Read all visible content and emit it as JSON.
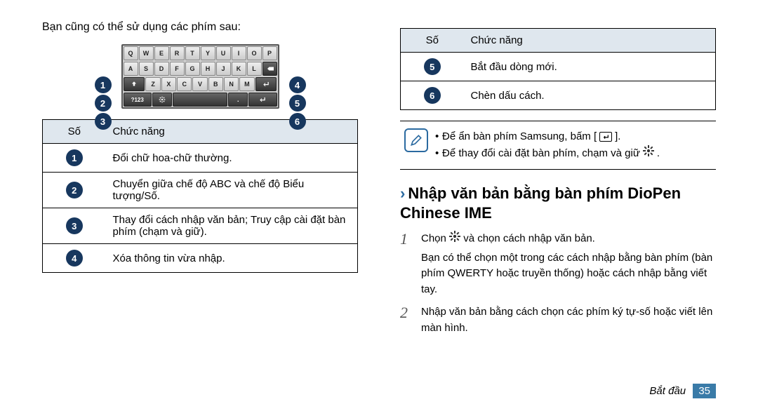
{
  "left": {
    "intro": "Bạn cũng có thể sử dụng các phím sau:",
    "keyboard_numbers": [
      "1",
      "2",
      "3",
      "4",
      "5",
      "6"
    ],
    "table": {
      "head": {
        "num": "Số",
        "func": "Chức năng"
      },
      "rows": [
        {
          "num": "1",
          "func": "Đổi chữ hoa-chữ thường."
        },
        {
          "num": "2",
          "func": "Chuyển giữa chế độ ABC và chế độ Biểu tượng/Số."
        },
        {
          "num": "3",
          "func": "Thay đổi cách nhập văn bản; Truy cập cài đặt bàn phím (chạm và giữ)."
        },
        {
          "num": "4",
          "func": "Xóa thông tin vừa nhập."
        }
      ]
    }
  },
  "right": {
    "table": {
      "head": {
        "num": "Số",
        "func": "Chức năng"
      },
      "rows": [
        {
          "num": "5",
          "func": "Bắt đầu dòng mới."
        },
        {
          "num": "6",
          "func": "Chèn dấu cách."
        }
      ]
    },
    "notes": {
      "line1_pre": "Để ẩn bàn phím Samsung, bấm [",
      "line1_post": "].",
      "line2_pre": "Để thay đổi cài đặt bàn phím, chạm và giữ ",
      "line2_post": "."
    },
    "section_title": "Nhập văn bản bằng bàn phím DioPen Chinese IME",
    "steps": [
      {
        "num": "1",
        "pre": "Chọn ",
        "post": " và chọn cách nhập văn bản.",
        "extra": "Bạn có thể chọn một trong các cách nhập bằng bàn phím (bàn phím QWERTY hoặc truyền thống) hoặc cách nhập bằng viết tay."
      },
      {
        "num": "2",
        "text": "Nhập văn bản bằng cách chọn các phím ký tự-số hoặc viết lên màn hình."
      }
    ]
  },
  "footer": {
    "label": "Bắt đầu",
    "page": "35"
  },
  "kbd": {
    "r1": [
      "Q",
      "W",
      "E",
      "R",
      "T",
      "Y",
      "U",
      "I",
      "O",
      "P"
    ],
    "r2": [
      "A",
      "S",
      "D",
      "F",
      "G",
      "H",
      "J",
      "K",
      "L"
    ],
    "r3": [
      "Z",
      "X",
      "C",
      "V",
      "B",
      "N",
      "M"
    ],
    "r4_mode": "?123"
  }
}
